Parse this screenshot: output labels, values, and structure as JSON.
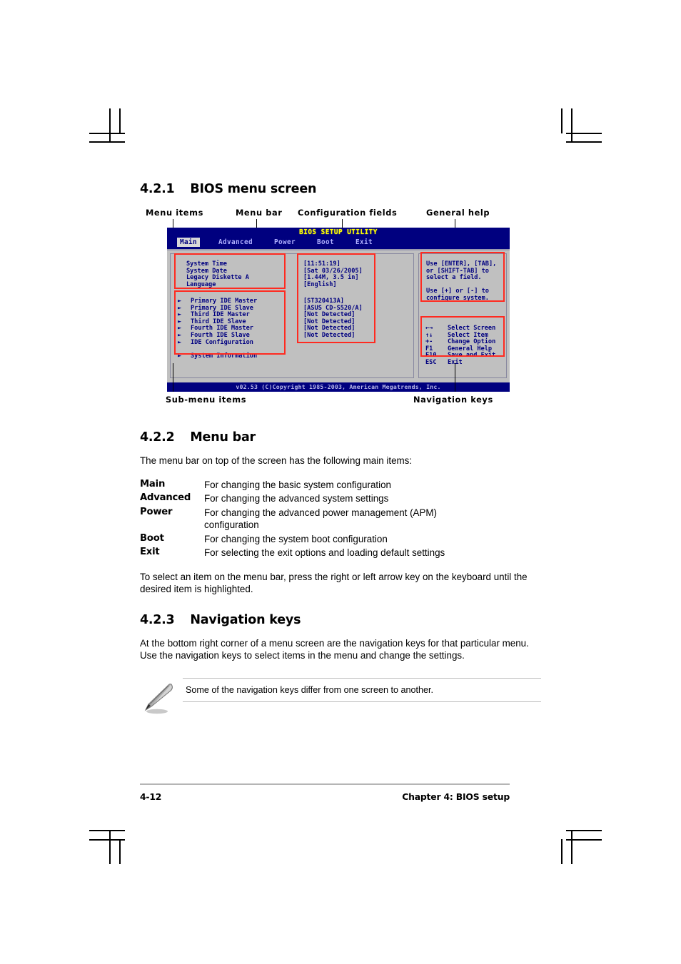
{
  "document": {
    "page_number": "4-12",
    "chapter_footer": "Chapter 4: BIOS setup"
  },
  "sections": {
    "s421": {
      "number": "4.2.1",
      "title": "BIOS menu screen"
    },
    "s422": {
      "number": "4.2.2",
      "title": "Menu bar"
    },
    "s423": {
      "number": "4.2.3",
      "title": "Navigation keys"
    }
  },
  "figure": {
    "callouts": {
      "menu_items": "Menu items",
      "menu_bar": "Menu bar",
      "configuration_fields": "Configuration fields",
      "general_help": "General help",
      "sub_menu_items": "Sub-menu items",
      "navigation_keys": "Navigation keys"
    },
    "bios": {
      "title": "BIOS SETUP UTILITY",
      "tabs": [
        {
          "label": "Main",
          "selected": true
        },
        {
          "label": "Advanced",
          "selected": false
        },
        {
          "label": "Power",
          "selected": false
        },
        {
          "label": "Boot",
          "selected": false
        },
        {
          "label": "Exit",
          "selected": false
        }
      ],
      "menu_items": [
        "System Time",
        "System Date",
        "Legacy Diskette A",
        "Language"
      ],
      "menu_item_values": [
        "[11:51:19]",
        "[Sat 03/26/2005]",
        "[1.44M, 3.5 in]",
        "[English]"
      ],
      "sub_menu_items": [
        "Primary IDE Master",
        "Primary IDE Slave",
        "Third IDE Master",
        "Third IDE Slave",
        "Fourth IDE Master",
        "Fourth IDE Slave",
        "IDE Configuration"
      ],
      "sub_menu_values": [
        "[ST320413A]",
        "[ASUS CD-S520/A]",
        "[Not Detected]",
        "[Not Detected]",
        "[Not Detected]",
        "[Not Detected]"
      ],
      "system_information": "System Information",
      "general_help": [
        "Use [ENTER], [TAB],",
        "or [SHIFT-TAB] to",
        "select a field.",
        "",
        "Use [+] or [-] to",
        "configure system."
      ],
      "navigation_keys": [
        {
          "key": "←→",
          "action": "Select Screen"
        },
        {
          "key": "↑↓",
          "action": "Select Item"
        },
        {
          "key": "+-",
          "action": "Change Option"
        },
        {
          "key": "F1",
          "action": "General Help"
        },
        {
          "key": "F10",
          "action": "Save and Exit"
        },
        {
          "key": "ESC",
          "action": "Exit"
        }
      ],
      "copyright": "v02.53 (C)Copyright 1985-2003, American Megatrends, Inc."
    }
  },
  "menu_bar_section": {
    "intro": "The menu bar on top of the screen has the following main items:",
    "items": [
      {
        "term": "Main",
        "desc": "For changing the basic system configuration"
      },
      {
        "term": "Advanced",
        "desc": "For changing the advanced system settings"
      },
      {
        "term": "Power",
        "desc": "For changing the advanced power management (APM) configuration"
      },
      {
        "term": "Boot",
        "desc": "For changing the system boot configuration"
      },
      {
        "term": "Exit",
        "desc": "For selecting the exit options and loading default settings"
      }
    ],
    "outro": "To select an item on the menu bar, press the right or left arrow key on the keyboard until the desired item is highlighted."
  },
  "navigation_keys_section": {
    "paragraph": "At the bottom right corner of a menu screen are the navigation keys for that particular menu. Use the navigation keys to select items in the menu and change the settings.",
    "note": "Some of the navigation keys differ from one screen to another."
  },
  "colors": {
    "bios_blue": "#00007f",
    "bios_gray": "#c0c0c0",
    "annotation_red": "#ff2a20",
    "bios_title_yellow": "#ffff00"
  }
}
